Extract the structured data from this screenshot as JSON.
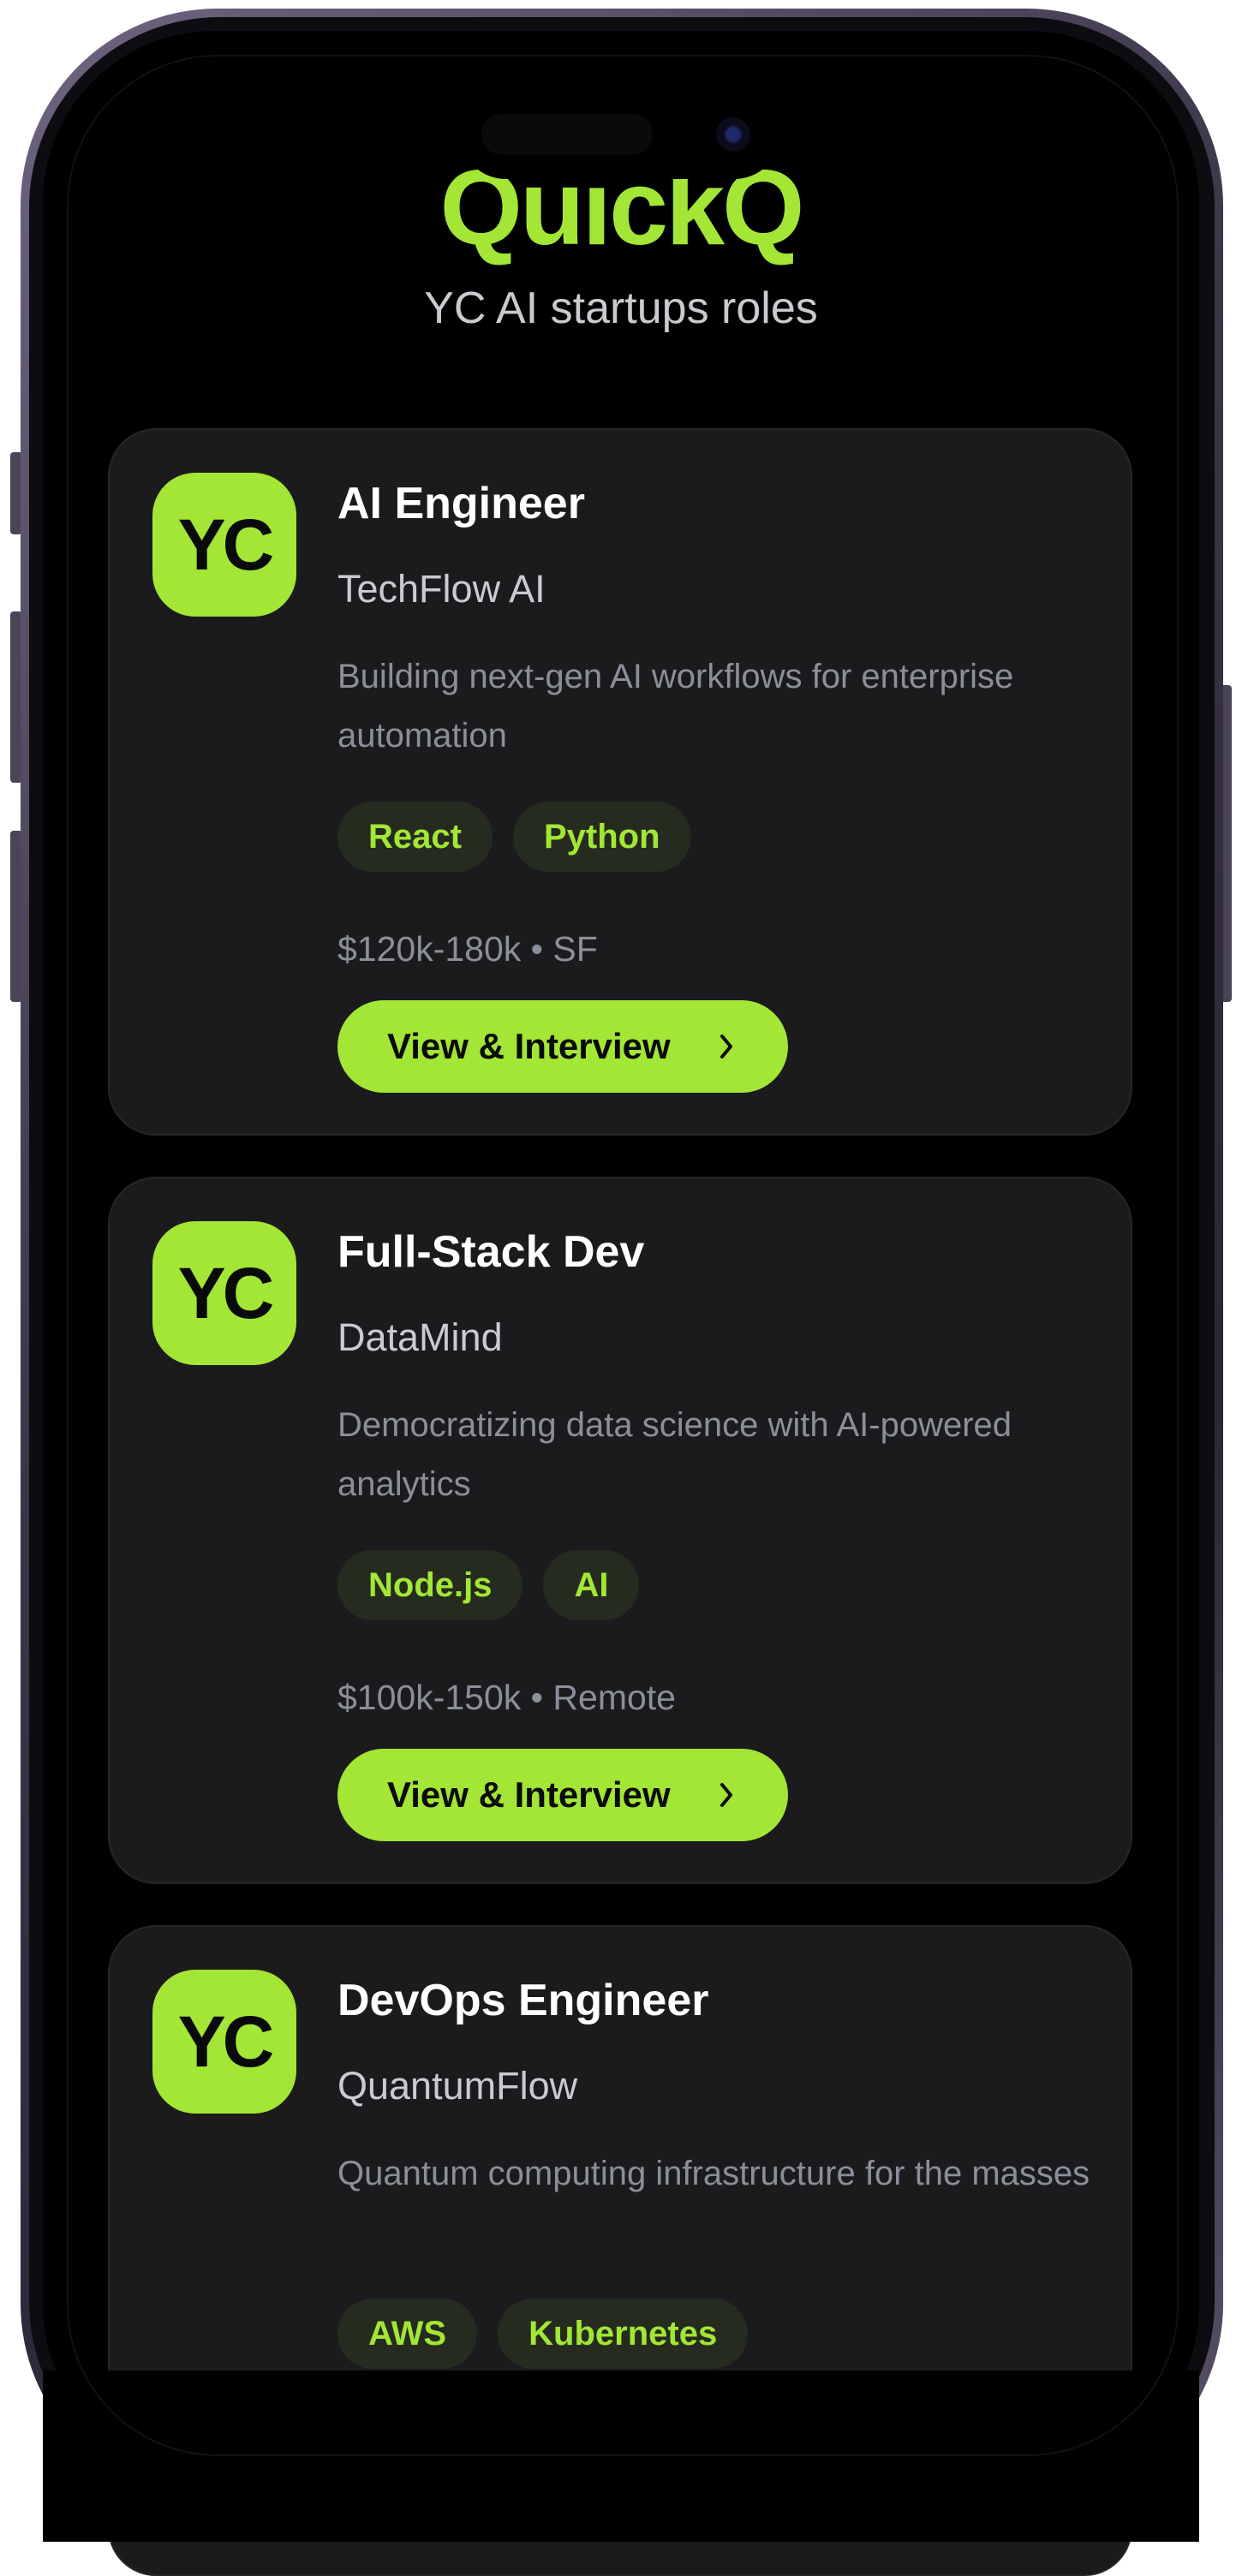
{
  "header": {
    "logo": "QuickQ",
    "subtitle": "YC AI startups roles"
  },
  "jobs": [
    {
      "badge": "YC",
      "role": "AI Engineer",
      "company": "TechFlow AI",
      "description": "Building next-gen AI workflows for enterprise automation",
      "tags": [
        "React",
        "Python"
      ],
      "meta": "$120k-180k • SF",
      "cta": "View & Interview"
    },
    {
      "badge": "YC",
      "role": "Full-Stack Dev",
      "company": "DataMind",
      "description": "Democratizing data science with AI-powered analytics",
      "tags": [
        "Node.js",
        "AI"
      ],
      "meta": "$100k-150k • Remote",
      "cta": "View & Interview"
    },
    {
      "badge": "YC",
      "role": "DevOps Engineer",
      "company": "QuantumFlow",
      "description": "Quantum computing infrastructure for the masses",
      "tags": [
        "AWS",
        "Kubernetes"
      ]
    }
  ],
  "colors": {
    "accent": "#a3e635",
    "card_bg": "#1b1b1d",
    "background": "#000000"
  },
  "icons": {
    "cta": "chevron-right-icon"
  }
}
